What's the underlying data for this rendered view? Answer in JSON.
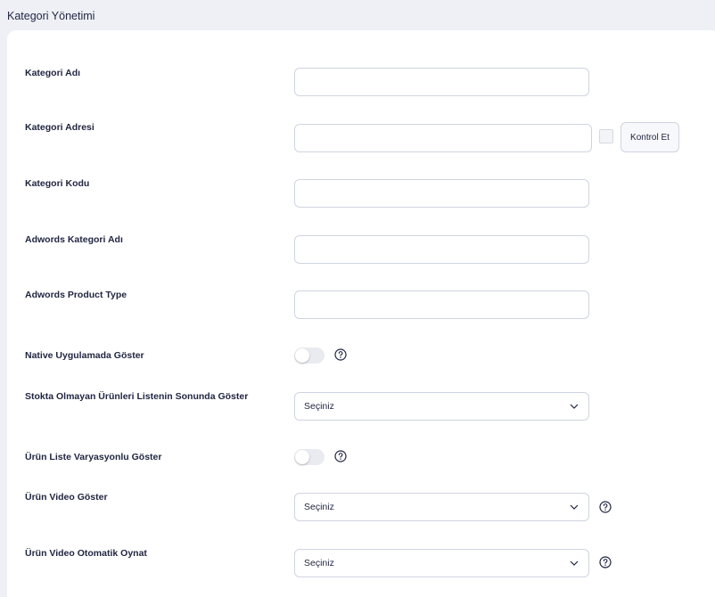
{
  "page": {
    "title": "Kategori Yönetimi"
  },
  "form": {
    "kategori_adi": {
      "label": "Kategori Adı",
      "value": ""
    },
    "kategori_adresi": {
      "label": "Kategori Adresi",
      "value": "",
      "check_button": "Kontrol Et"
    },
    "kategori_kodu": {
      "label": "Kategori Kodu",
      "value": ""
    },
    "adwords_kategori_adi": {
      "label": "Adwords Kategori Adı",
      "value": ""
    },
    "adwords_product_type": {
      "label": "Adwords Product Type",
      "value": ""
    },
    "native_uygulama": {
      "label": "Native Uygulamada Göster",
      "toggle_on": false,
      "help_icon": "question-circle-icon"
    },
    "stokta_olmayan": {
      "label": "Stokta Olmayan Ürünleri Listenin Sonunda Göster",
      "selected": "Seçiniz"
    },
    "urun_liste_varyasyon": {
      "label": "Ürün Liste Varyasyonlu Göster",
      "toggle_on": false,
      "help_icon": "question-circle-icon"
    },
    "urun_video_goster": {
      "label": "Ürün Video Göster",
      "selected": "Seçiniz",
      "help_icon": "question-circle-icon"
    },
    "urun_video_otomatik": {
      "label": "Ürün Video Otomatik Oynat",
      "selected": "Seçiniz",
      "help_icon": "question-circle-icon"
    }
  },
  "colors": {
    "background": "#eef0f6",
    "card": "#ffffff",
    "text": "#1f2440",
    "border": "#cfd4e0"
  }
}
